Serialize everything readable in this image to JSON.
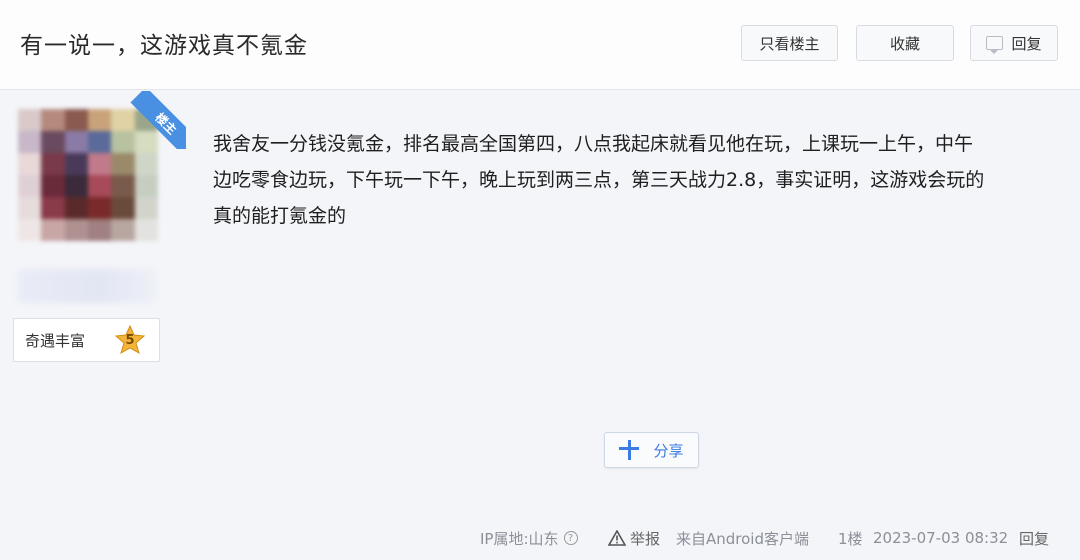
{
  "header": {
    "title": "有一说一，这游戏真不氪金",
    "buttons": {
      "only_author": "只看楼主",
      "favorite": "收藏",
      "reply": "回复"
    }
  },
  "user": {
    "owner_badge": "楼主",
    "tag": "奇遇丰富",
    "level": "5"
  },
  "post": {
    "lines": [
      "我舍友一分钱没氪金，排名最高全国第四，八点我起床就看见他在玩，上课玩一上午，中午",
      "边吃零食边玩，下午玩一下午，晚上玩到两三点，第三天战力2.8，事实证明，这游戏会玩的",
      "真的能打氪金的"
    ],
    "share_label": "分享"
  },
  "footer": {
    "ip_location": "IP属地:山东",
    "report": "举报",
    "source": "来自Android客户端",
    "floor": "1楼",
    "timestamp": "2023-07-03 08:32",
    "reply": "回复"
  },
  "colors": {
    "accent": "#3b7be3",
    "badge": "#4a90e2",
    "level_star": "#f3b43a"
  }
}
